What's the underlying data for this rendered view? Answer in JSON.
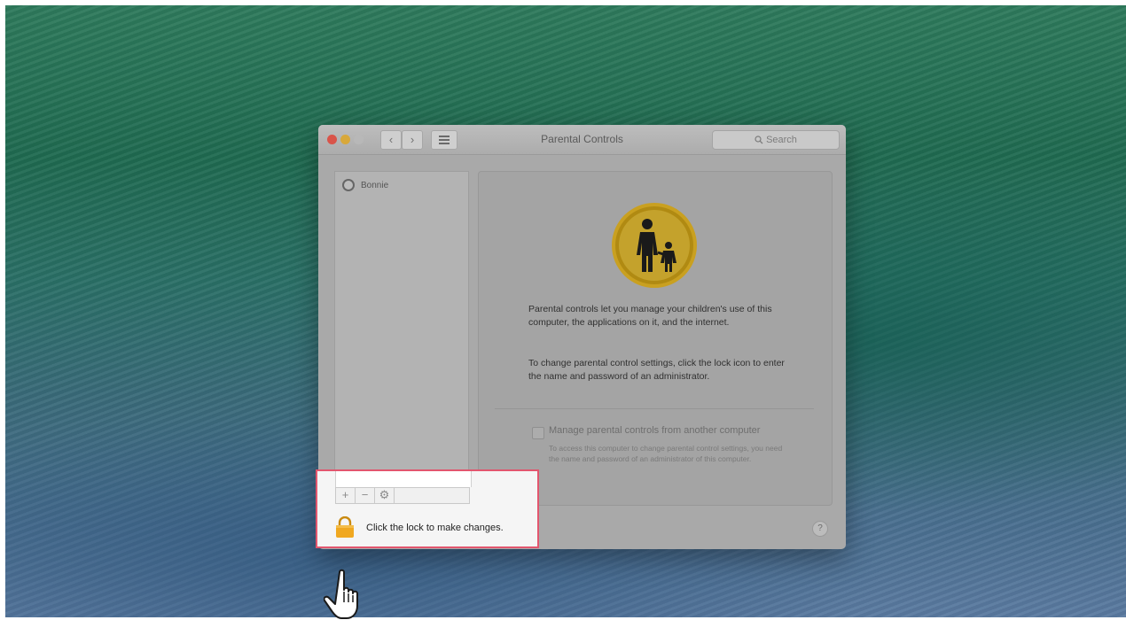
{
  "window": {
    "title": "Parental Controls",
    "search_placeholder": "Search"
  },
  "sidebar": {
    "users": [
      {
        "name": "Bonnie"
      }
    ]
  },
  "main": {
    "description_1": "Parental controls let you manage your children's use of this computer, the applications on it, and the internet.",
    "description_2": "To change parental control settings, click the lock icon to enter the name and password of an administrator.",
    "remote_label": "Manage parental controls from another computer",
    "remote_help": "To access this computer to change parental control settings, you need the name and password of an administrator of this computer."
  },
  "toolbar": {
    "add": "+",
    "remove": "−",
    "action": "⚙"
  },
  "lock": {
    "label": "Click the lock to make changes."
  },
  "help": "?",
  "colors": {
    "highlight_border": "#e2566e",
    "lock_color": "#f0a820",
    "parental_icon": "#c9a020"
  }
}
